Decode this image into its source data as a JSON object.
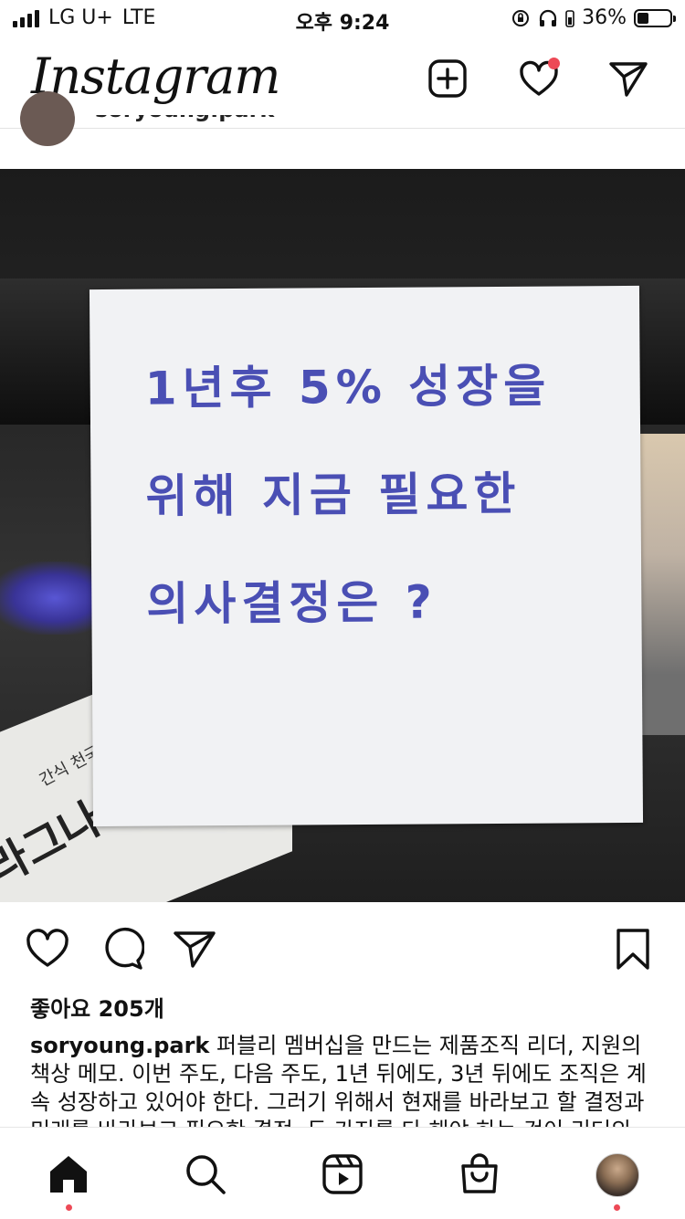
{
  "status_bar": {
    "carrier": "LG U+",
    "network": "LTE",
    "time": "오후 9:24",
    "battery": "36%"
  },
  "header": {
    "logo": "Instagram",
    "icons": [
      "plus-square-icon",
      "heart-icon",
      "send-icon"
    ]
  },
  "previous_post": {
    "username": "soryoung.park"
  },
  "post": {
    "note_text": "1년후 5% 성장을\n위해 지금 필요한\n의사결정은 ?",
    "book_title": "라그나",
    "book_subtitle": "간식 천국",
    "likes": "좋아요 205개",
    "username": "soryoung.park",
    "caption": "퍼블리 멤버십을 만드는 제품조직 리더, 지원의 책상 메모. 이번 주도, 다음 주도, 1년 뒤에도, 3년 뒤에도 조직은 계속 성장하고 있어야 한다. 그러기 위해서 현재를 바라보고 할 결정과 미래를 바라보고 필요한 결정, 두 가지를 다 해야 하는 것이 리더의"
  },
  "actions": {
    "icons": [
      "heart-icon",
      "comment-icon",
      "share-icon",
      "bookmark-icon"
    ]
  },
  "tabbar": {
    "icons": [
      "home-icon",
      "search-icon",
      "reels-icon",
      "shop-icon",
      "profile-avatar"
    ]
  },
  "colors": {
    "accent_red": "#ed4956",
    "ink_blue": "#4a4fb4"
  }
}
